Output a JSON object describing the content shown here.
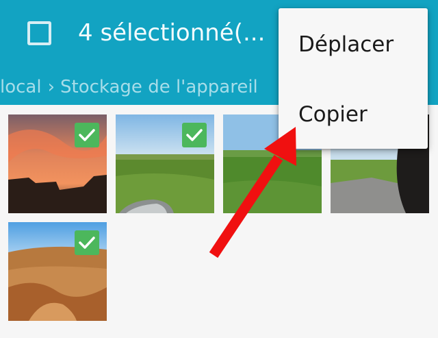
{
  "header": {
    "selection_title": "4 sélectionné(...",
    "accent_color": "#12a3c2"
  },
  "breadcrumb": {
    "items": [
      "local",
      "Stockage de l'appareil"
    ]
  },
  "menu": {
    "items": [
      {
        "label": "Déplacer"
      },
      {
        "label": "Copier"
      }
    ]
  },
  "gallery": {
    "thumbnails": [
      {
        "subject": "sunset sky",
        "selected": true
      },
      {
        "subject": "green field",
        "selected": true
      },
      {
        "subject": "green field",
        "selected": false
      },
      {
        "subject": "road and field",
        "selected": false
      },
      {
        "subject": "desert hills",
        "selected": true
      }
    ],
    "check_color": "#4cb75c"
  },
  "annotation": {
    "arrow_color": "#f01010"
  }
}
